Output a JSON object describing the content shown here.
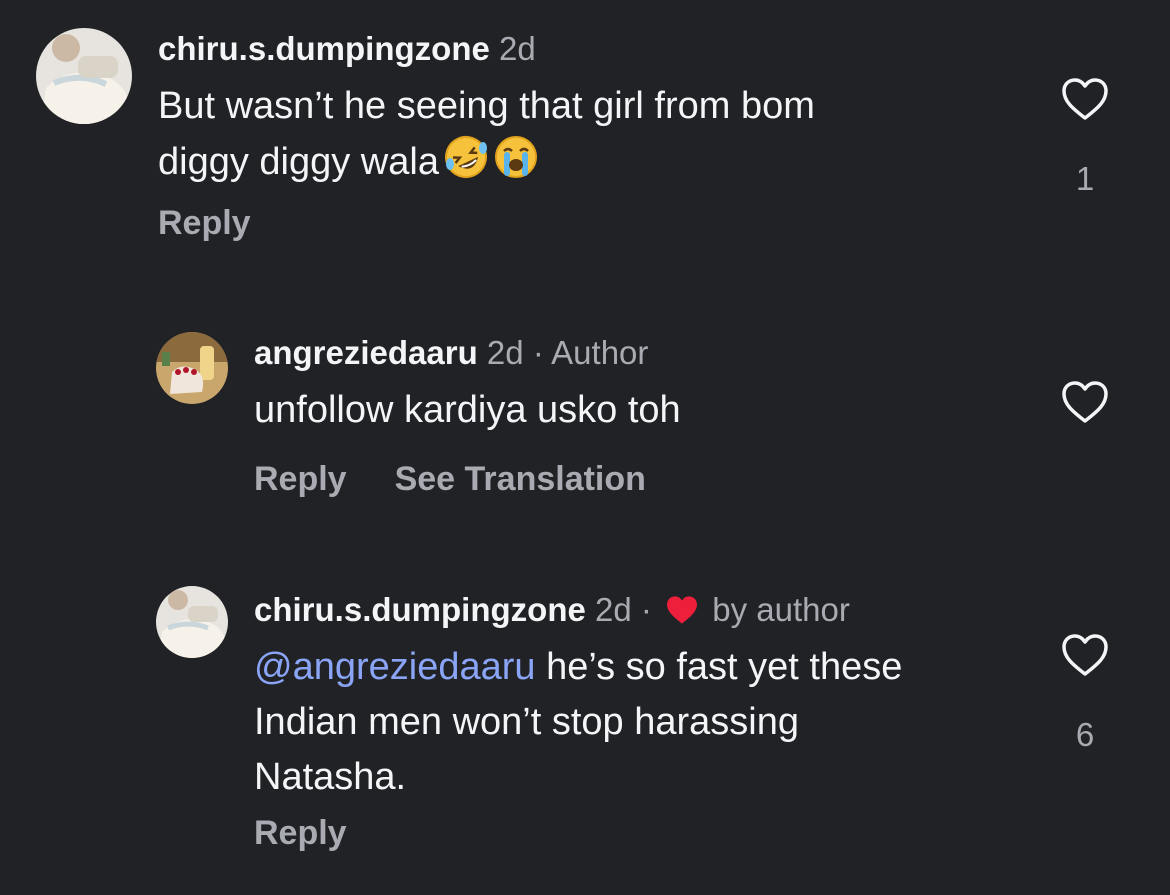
{
  "comments": [
    {
      "username": "chiru.s.dumpingzone",
      "time": "2d",
      "text_line1": "But wasn’t he seeing that girl from bom",
      "text_line2": "diggy diggy wala",
      "emojis": [
        "rolling-on-floor-laughing-emoji",
        "loudly-crying-emoji"
      ],
      "reply_label": "Reply",
      "like_count": "1"
    },
    {
      "username": "angreziedaaru",
      "time": "2d",
      "separator": "·",
      "badge": "Author",
      "text": "unfollow kardiya usko toh",
      "reply_label": "Reply",
      "translate_label": "See Translation"
    },
    {
      "username": "chiru.s.dumpingzone",
      "time": "2d",
      "separator": "·",
      "liked_by": "by author",
      "mention": "@angreziedaaru",
      "text_line1": " he’s so fast yet these",
      "text_line2": "Indian men won’t stop harassing",
      "text_line3": "Natasha.",
      "reply_label": "Reply",
      "like_count": "6"
    }
  ],
  "colors": {
    "background": "#212226",
    "primary_text": "#f3f5f7",
    "secondary_text": "#a8abb1",
    "mention": "#8aa4f6",
    "author_heart": "#ed1f3a"
  }
}
